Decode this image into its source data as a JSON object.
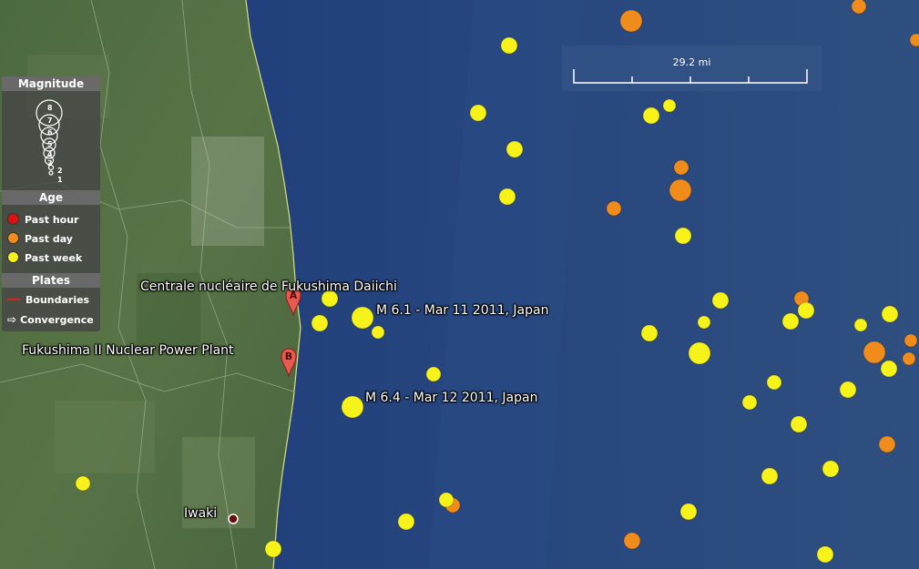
{
  "map": {
    "scale_label": "29.2 mi",
    "places": [
      {
        "label": "Centrale nucléaire de Fukushima Daiichi",
        "marker": "A"
      },
      {
        "label": "Fukushima II Nuclear Power Plant",
        "marker": "B"
      },
      {
        "label": "Iwaki"
      }
    ],
    "quake_labels": [
      "M 6.1 - Mar 11 2011, Japan",
      "M 6.4 - Mar 12 2011, Japan"
    ],
    "colors": {
      "past_hour": "#e01010",
      "past_day": "#f08c1c",
      "past_week": "#f6f21a",
      "ocean": "#2a4a7a",
      "land": "#4f6a3e"
    }
  },
  "legend": {
    "magnitude_title": "Magnitude",
    "magnitude_values": [
      "8",
      "7",
      "6",
      "5",
      "4",
      "3",
      "2",
      "1"
    ],
    "age_title": "Age",
    "age_items": [
      {
        "label": "Past hour",
        "color": "#e01010"
      },
      {
        "label": "Past day",
        "color": "#f08c1c"
      },
      {
        "label": "Past week",
        "color": "#f6f21a"
      }
    ],
    "plates_title": "Plates",
    "boundaries_label": "Boundaries",
    "convergence_label": "Convergence"
  }
}
